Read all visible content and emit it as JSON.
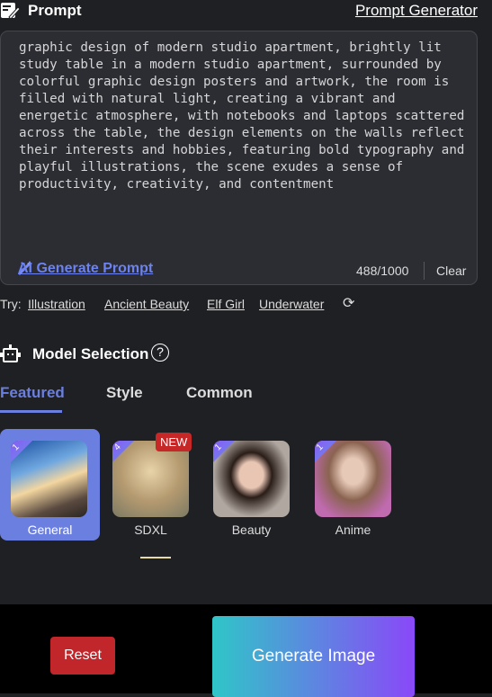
{
  "header": {
    "title": "Prompt",
    "prompt_generator": "Prompt Generator"
  },
  "prompt": {
    "value": "graphic design of modern studio apartment, brightly lit study table in a modern studio apartment, surrounded by colorful graphic design posters and artwork, the room is filled with natural light, creating a vibrant and energetic atmosphere, with notebooks and laptops scattered across the table, the design elements on the walls reflect their interests and hobbies, featuring bold typography and playful illustrations, the scene exudes a sense of productivity, creativity, and contentment",
    "ai_generate": "AI Generate Prompt",
    "count": "488/1000",
    "clear": "Clear"
  },
  "try": {
    "label": "Try:",
    "items": [
      "Illustration",
      "Ancient Beauty",
      "Elf Girl",
      "Underwater"
    ]
  },
  "models": {
    "title": "Model Selection",
    "tabs": [
      "Featured",
      "Style",
      "Common"
    ],
    "active_tab": "Featured",
    "items": [
      {
        "label": "General",
        "cost": "1",
        "selected": true
      },
      {
        "label": "SDXL",
        "cost": "4",
        "badge": "NEW"
      },
      {
        "label": "Beauty",
        "cost": "1"
      },
      {
        "label": "Anime",
        "cost": "1"
      }
    ]
  },
  "actions": {
    "reset": "Reset",
    "generate": "Generate Image"
  },
  "colors": {
    "accent": "#6b7fe0",
    "reset": "#c0262a"
  }
}
